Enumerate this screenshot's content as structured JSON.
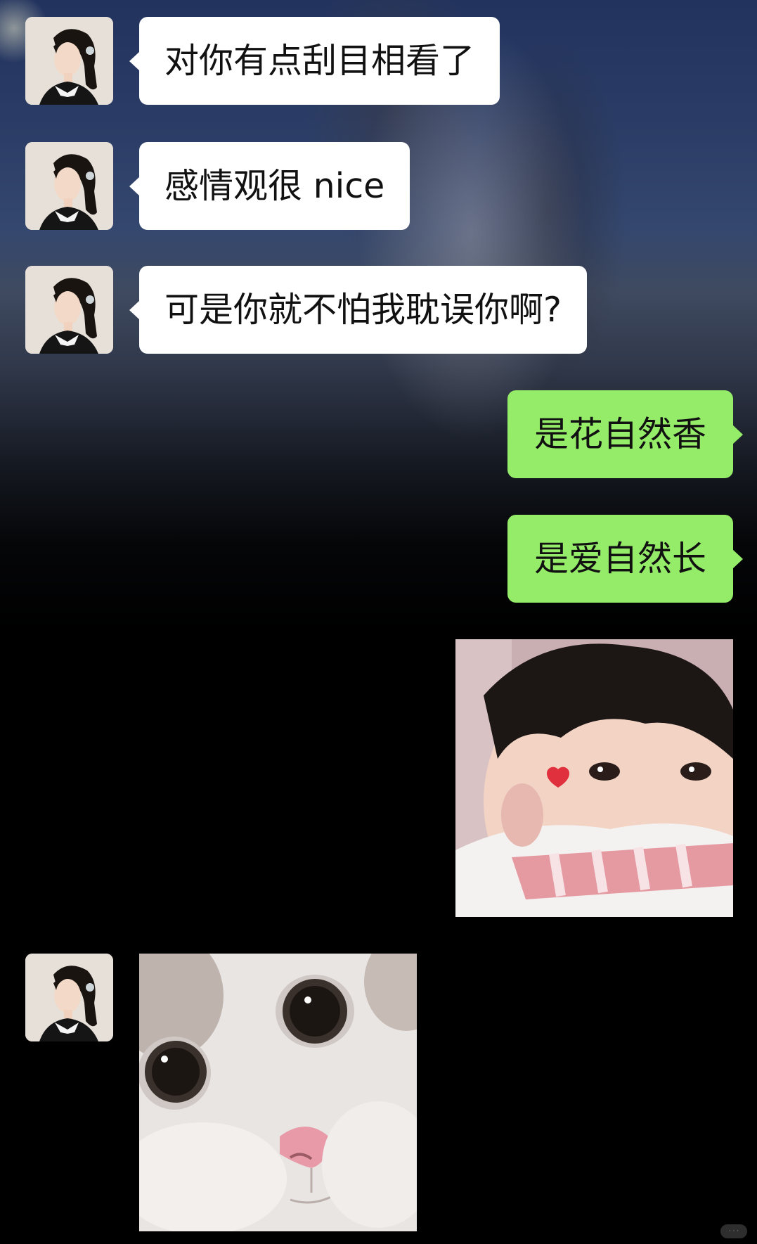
{
  "messages": [
    {
      "direction": "incoming",
      "type": "text",
      "text": "对你有点刮目相看了"
    },
    {
      "direction": "incoming",
      "type": "text",
      "text": "感情观很 nice"
    },
    {
      "direction": "incoming",
      "type": "text",
      "text": "可是你就不怕我耽误你啊?"
    },
    {
      "direction": "outgoing",
      "type": "text",
      "text": "是花自然香"
    },
    {
      "direction": "outgoing",
      "type": "text",
      "text": "是爱自然长"
    },
    {
      "direction": "outgoing",
      "type": "sticker",
      "sticker": "toddler-peeking-sticker"
    },
    {
      "direction": "incoming",
      "type": "sticker",
      "sticker": "white-cat-closeup-sticker"
    }
  ],
  "colors": {
    "incoming_bubble": "#ffffff",
    "outgoing_bubble": "#95ec69",
    "background": "#000000",
    "wallpaper_blue": "#2b3d66"
  },
  "icons": {
    "avatar": "girl-profile-avatar"
  }
}
